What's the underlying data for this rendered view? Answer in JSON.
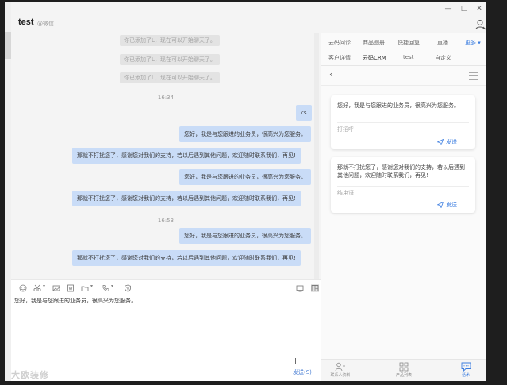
{
  "chat": {
    "title": "test",
    "subtitle": "@微信",
    "system_messages": [
      "你已添加了L，现在可以开始聊天了。",
      "你已添加了L，现在可以开始聊天了。",
      "你已添加了L，现在可以开始聊天了。"
    ],
    "time1": "16:34",
    "time2": "16:53",
    "bubbles": [
      "cs",
      "您好，我是与您跟进的业务员，很高兴为您服务。",
      "那就不打扰您了，感谢您对我们的支持，若以后遇到其他问题，欢迎随时联系我们，再见!",
      "您好，我是与您跟进的业务员，很高兴为您服务。",
      "那就不打扰您了，感谢您对我们的支持，若以后遇到其他问题，欢迎随时联系我们，再见!",
      "您好，我是与您跟进的业务员，很高兴为您服务。",
      "那就不打扰您了，感谢您对我们的支持，若以后遇到其他问题，欢迎随时联系我们，再见!"
    ]
  },
  "window": {
    "minimize": "—",
    "maximize": "□",
    "close": "✕"
  },
  "input": {
    "text": "您好，我是与您跟进的业务员，很高兴为您服务。",
    "send_label": "发送(S)",
    "cursor": "I"
  },
  "watermark": "大欧装修",
  "panel": {
    "tabs_row1": [
      "云码问诊",
      "商品图册",
      "快捷回复",
      "直播"
    ],
    "more": "更多 ▾",
    "tabs_row2": [
      "客户详情",
      "云码CRM",
      "test",
      "自定义"
    ],
    "back": "‹",
    "cards": [
      {
        "text": "您好，我是与您跟进的业务员，很高兴为您服务。",
        "tag": "打招呼",
        "send": "发送"
      },
      {
        "text": "那就不打扰您了，感谢您对我们的支持，若以后遇到其他问题，欢迎随时联系我们，再见!",
        "tag": "结束语",
        "send": "发送"
      }
    ],
    "nav": [
      "联系人资料",
      "产品列表",
      "话术"
    ]
  },
  "colors": {
    "accent": "#3b7de0",
    "bubble": "#c9dcf7",
    "system_bg": "#e3e3e3"
  }
}
